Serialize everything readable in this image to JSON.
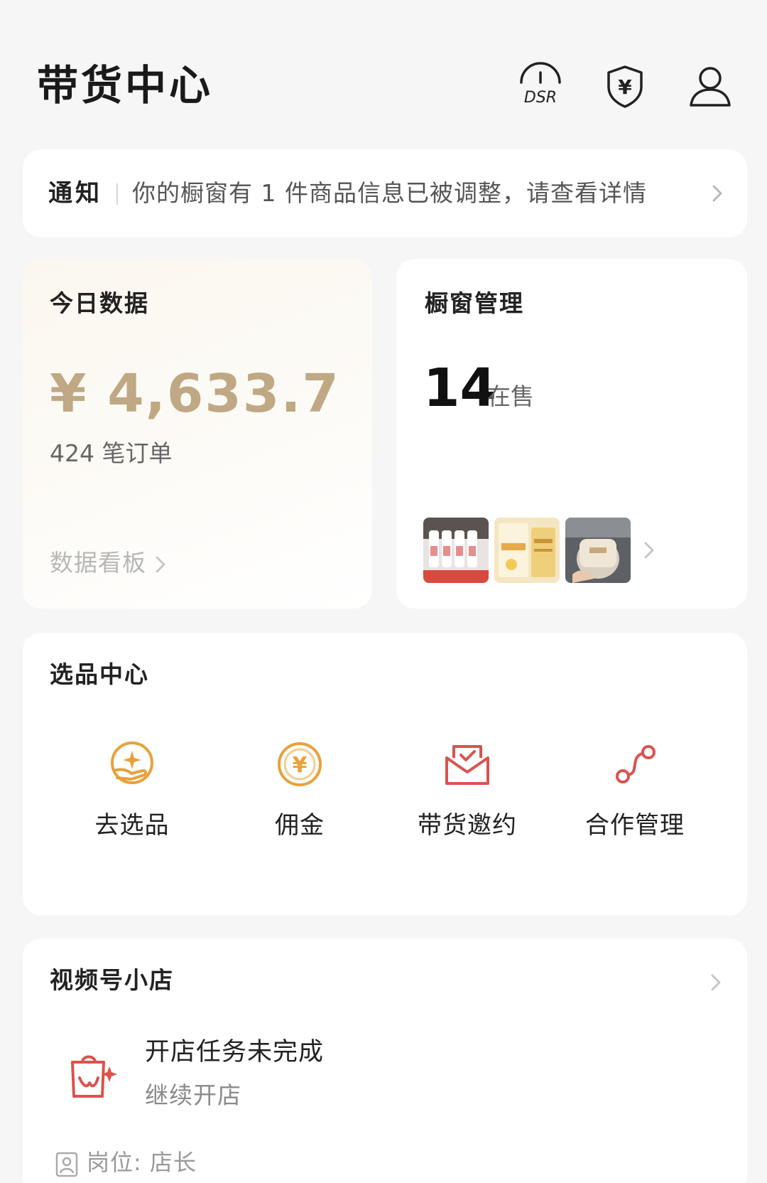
{
  "header": {
    "title": "带货中心",
    "dsr_label": "DSR",
    "icons": [
      "dsr-gauge-icon",
      "yuan-shield-icon",
      "user-icon"
    ]
  },
  "notice": {
    "label": "通知",
    "text": "你的橱窗有 1 件商品信息已被调整，请查看详情"
  },
  "today": {
    "title": "今日数据",
    "amount": "¥ 4,633.7",
    "orders": "424 笔订单",
    "link": "数据看板"
  },
  "window": {
    "title": "橱窗管理",
    "count": "14",
    "count_label": "在售",
    "thumbnails": [
      "product-thumbnail-bottles",
      "product-thumbnail-cream-box",
      "product-thumbnail-jar"
    ]
  },
  "select_center": {
    "title": "选品中心",
    "items": [
      {
        "label": "去选品",
        "icon": "sparkle-hand-icon"
      },
      {
        "label": "佣金",
        "icon": "yuan-coin-icon"
      },
      {
        "label": "带货邀约",
        "icon": "invite-envelope-icon"
      },
      {
        "label": "合作管理",
        "icon": "cooperation-nodes-icon"
      }
    ]
  },
  "shop": {
    "title": "视频号小店",
    "task": "开店任务未完成",
    "continue": "继续开店",
    "position": "岗位: 店长"
  },
  "colors": {
    "accent_gold": "#bfa883",
    "icon_orange": "#e7a13b",
    "icon_red": "#d9534f",
    "background": "#f6f6f6",
    "card": "#ffffff"
  }
}
